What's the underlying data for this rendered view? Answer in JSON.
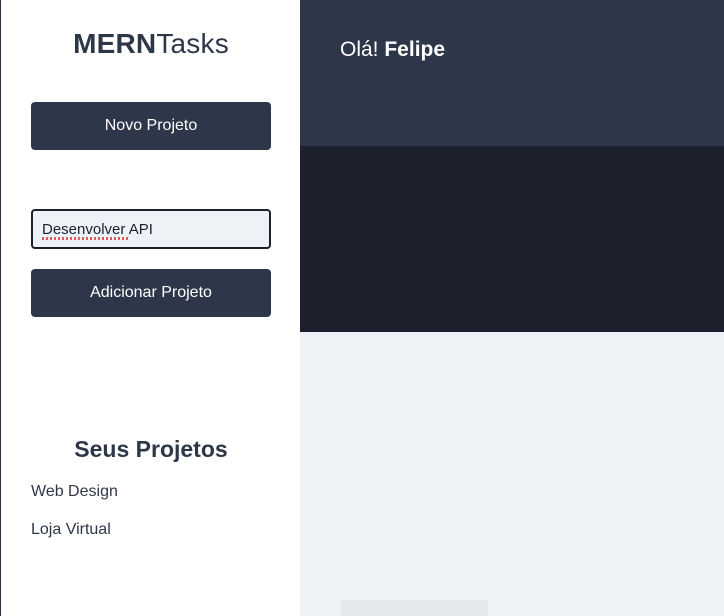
{
  "logo": {
    "bold": "MERN",
    "light": "Tasks"
  },
  "sidebar": {
    "new_project_button": "Novo Projeto",
    "project_input_value": "Desenvolver API",
    "add_project_button": "Adicionar Projeto",
    "projects_title": "Seus Projetos",
    "projects": [
      "Web Design",
      "Loja Virtual"
    ]
  },
  "header": {
    "greeting_prefix": "Olá! ",
    "user_name": "Felipe"
  },
  "colors": {
    "primary": "#2e3749",
    "dark": "#1b202c",
    "background": "#edf2f7",
    "text": "#2d3748"
  }
}
